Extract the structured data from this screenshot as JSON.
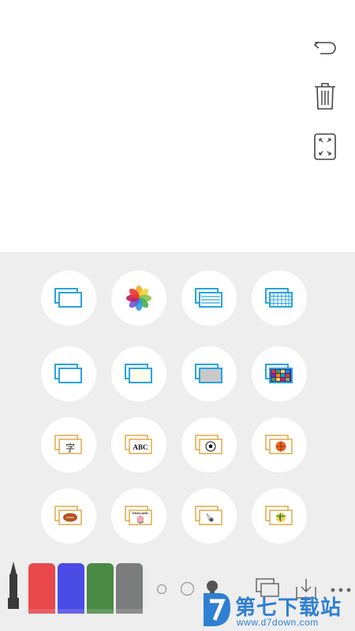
{
  "toolbar": {
    "undo_icon": "undo-icon",
    "trash_icon": "trash-icon",
    "fullscreen_icon": "expand-icon"
  },
  "template_grid": {
    "rows": [
      [
        {
          "icon": "blank-page-icon"
        },
        {
          "icon": "photos-icon"
        },
        {
          "icon": "lined-page-icon"
        },
        {
          "icon": "grid-page-icon"
        }
      ],
      [
        {
          "icon": "white-board-icon"
        },
        {
          "icon": "cream-board-icon"
        },
        {
          "icon": "gray-board-icon"
        },
        {
          "icon": "color-grid-board-icon"
        }
      ],
      [
        {
          "icon": "chinese-character-card-icon",
          "label": "字"
        },
        {
          "icon": "abc-card-icon",
          "label": "ABC"
        },
        {
          "icon": "soccer-card-icon"
        },
        {
          "icon": "basketball-card-icon"
        }
      ],
      [
        {
          "icon": "rugby-card-icon"
        },
        {
          "icon": "england-card-icon",
          "label": "ENGLAND"
        },
        {
          "icon": "badminton-card-icon"
        },
        {
          "icon": "volleyball-card-icon"
        }
      ]
    ]
  },
  "bottom_bar": {
    "markers": [
      {
        "name": "black-marker",
        "color": "#3a3a3a"
      },
      {
        "name": "red-marker",
        "color": "#e8484b"
      },
      {
        "name": "blue-marker",
        "color": "#4b4be6"
      },
      {
        "name": "green-marker",
        "color": "#4a8a45"
      },
      {
        "name": "gray-marker",
        "color": "#7b7d7d"
      }
    ],
    "sizes": [
      "small",
      "medium",
      "large"
    ]
  },
  "watermark": {
    "title": "第七下载站",
    "url": "www.d7down.com"
  },
  "colors": {
    "accent_blue": "#29a3e0",
    "panel_bg": "#eeeeee"
  }
}
